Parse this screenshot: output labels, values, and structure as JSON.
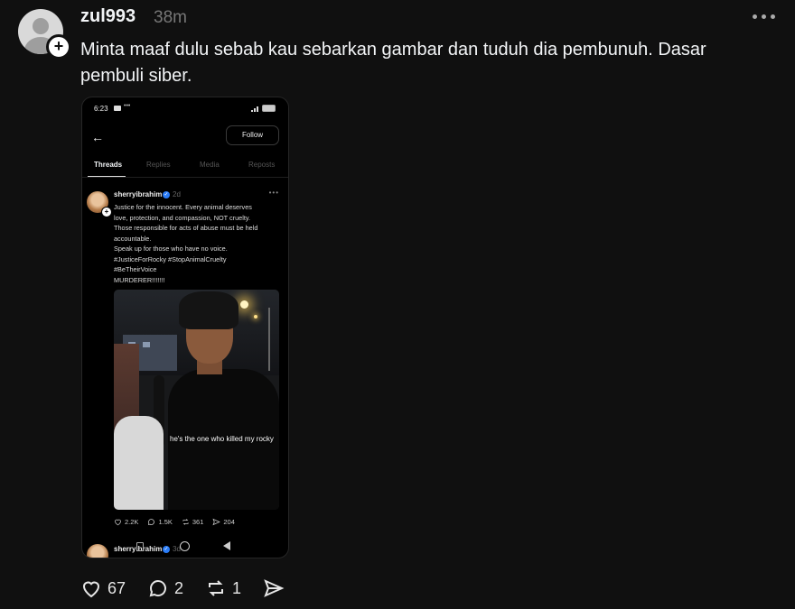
{
  "post": {
    "username": "zul993",
    "time": "38m",
    "caption_line1": "Minta maaf dulu sebab kau sebarkan gambar dan tuduh dia pembunuh. Dasar",
    "caption_line2": "pembuli siber.",
    "likes": "67",
    "replies": "2",
    "reposts": "1"
  },
  "screenshot": {
    "clock": "6:23",
    "status_dots": "•••",
    "follow_label": "Follow",
    "tabs": [
      "Threads",
      "Replies",
      "Media",
      "Reposts"
    ],
    "inner_post": {
      "username": "sherryibrahim",
      "time": "2d",
      "more": "•••",
      "lines": [
        "Justice for the innocent. Every animal deserves",
        "love, protection, and compassion, NOT cruelty.",
        "Those responsible for acts of abuse must be held",
        "accountable.",
        "Speak up for those who have no voice.",
        "#JusticeForRocky  #StopAnimalCruelty",
        "#BeTheirVoice",
        "MURDERER!!!!!!!"
      ],
      "photo_caption": "he's the one who killed my rocky",
      "likes": "2.2K",
      "replies": "1.5K",
      "reposts": "361",
      "shares": "204"
    },
    "next_post": {
      "username": "sherryibrahim",
      "time": "3d"
    }
  },
  "colors": {
    "background": "#101010",
    "text": "#f3f5f7",
    "muted": "#777777",
    "verified": "#2a7cf7"
  }
}
